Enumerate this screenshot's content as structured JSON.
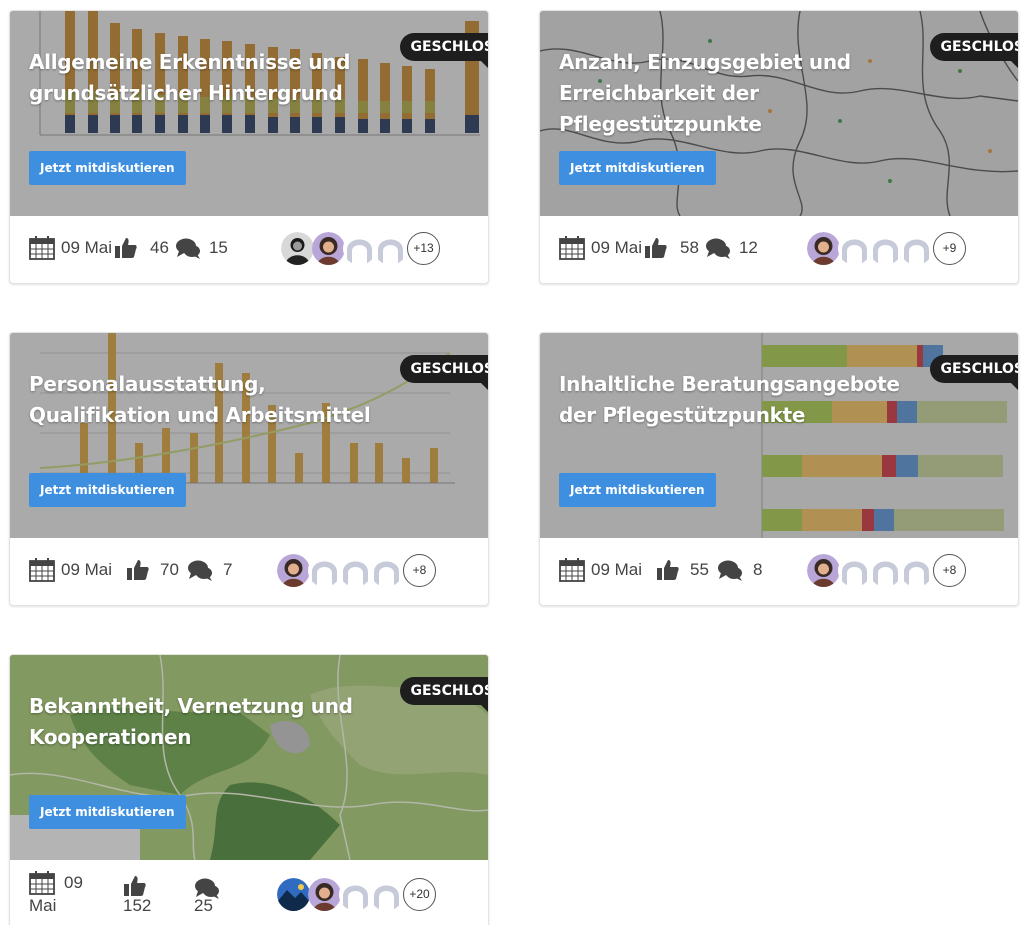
{
  "cta_label": "Jetzt mitdiskutieren",
  "badge_label": "GESCHLOS",
  "cards": [
    {
      "title": "Allgemeine Erkenntnisse und grundsätzlicher Hintergrund",
      "date": "09 Mai",
      "likes": "46",
      "comments": "15",
      "more": "+13",
      "avatars": [
        "photo-person",
        "photo-woman",
        "placeholder",
        "placeholder"
      ]
    },
    {
      "title": "Anzahl, Einzugsgebiet und Erreichbarkeit der Pflegestützpunkte",
      "date": "09 Mai",
      "likes": "58",
      "comments": "12",
      "more": "+9",
      "avatars": [
        "photo-woman",
        "placeholder",
        "placeholder",
        "placeholder"
      ]
    },
    {
      "title": "Personalausstattung, Qualifikation und Arbeitsmittel",
      "date": "09 Mai",
      "likes": "70",
      "comments": "7",
      "more": "+8",
      "avatars": [
        "photo-woman",
        "placeholder",
        "placeholder",
        "placeholder"
      ]
    },
    {
      "title": "Inhaltliche Beratungsangebote der Pflegestützpunkte",
      "date": "09 Mai",
      "likes": "55",
      "comments": "8",
      "more": "+8",
      "avatars": [
        "photo-woman",
        "placeholder",
        "placeholder",
        "placeholder"
      ]
    },
    {
      "title": "Bekanntheit, Vernetzung und Kooperationen",
      "date_day": "09",
      "date_month": "Mai",
      "likes": "152",
      "comments": "25",
      "more": "+20",
      "avatars": [
        "photo-landscape",
        "photo-woman",
        "placeholder",
        "placeholder"
      ]
    }
  ],
  "icons": {
    "date": "calendar-icon",
    "likes": "thumbs-up-icon",
    "comments": "comments-icon",
    "accent": "#3e8fe0",
    "badge_bg": "#1e1e1e"
  }
}
